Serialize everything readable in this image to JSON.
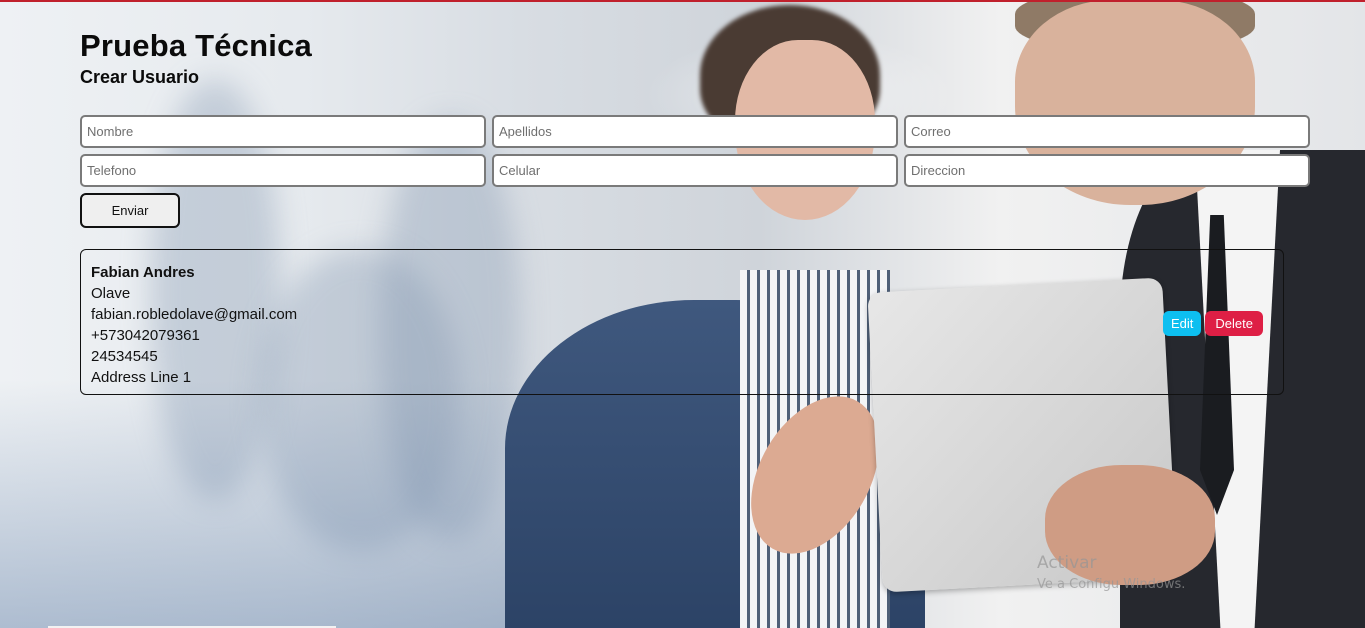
{
  "header": {
    "title": "Prueba Técnica",
    "subtitle": "Crear Usuario"
  },
  "form": {
    "fields": [
      {
        "placeholder": "Nombre",
        "value": ""
      },
      {
        "placeholder": "Apellidos",
        "value": ""
      },
      {
        "placeholder": "Correo",
        "value": ""
      },
      {
        "placeholder": "Telefono",
        "value": ""
      },
      {
        "placeholder": "Celular",
        "value": ""
      },
      {
        "placeholder": "Direccion",
        "value": ""
      }
    ],
    "submit_label": "Enviar"
  },
  "users": [
    {
      "nombre": "Fabian Andres",
      "apellidos": "Olave",
      "correo": "fabian.robledolave@gmail.com",
      "telefono": "+573042079361",
      "celular": "24534545",
      "direccion": "Address Line 1",
      "edit_label": "Edit",
      "delete_label": "Delete"
    }
  ],
  "colors": {
    "accent_top": "#c0202c",
    "edit_button": "#0dbff0",
    "delete_button": "#de1f45"
  },
  "watermark": {
    "line1": "Activar",
    "line2": "Ve a Configu                      Windows."
  }
}
